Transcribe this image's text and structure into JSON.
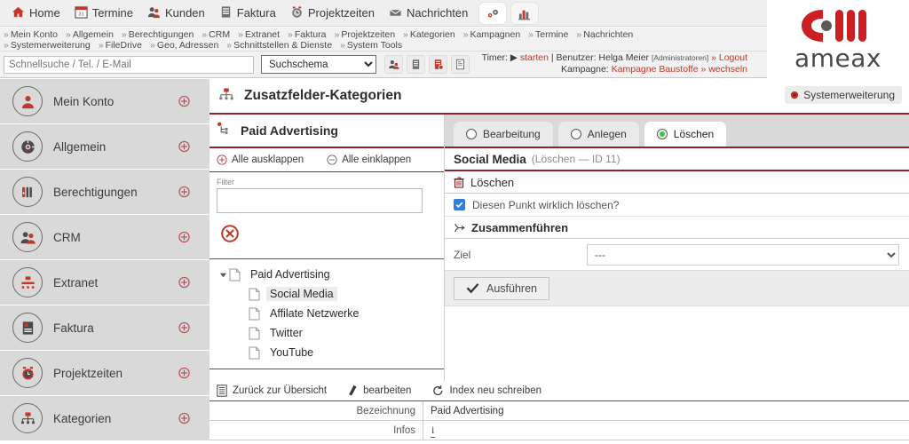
{
  "brand": {
    "accent": "#8d2230",
    "red": "#c0392b",
    "wordmark": "ameax"
  },
  "topnav": {
    "items": [
      {
        "label": "Home",
        "icon": "home-icon"
      },
      {
        "label": "Termine",
        "icon": "calendar-icon"
      },
      {
        "label": "Kunden",
        "icon": "customers-icon"
      },
      {
        "label": "Faktura",
        "icon": "invoice-icon"
      },
      {
        "label": "Projektzeiten",
        "icon": "clock-icon"
      },
      {
        "label": "Nachrichten",
        "icon": "mail-icon"
      }
    ],
    "buttons": [
      {
        "name": "settings-gear-icon"
      },
      {
        "name": "bar-chart-icon"
      }
    ]
  },
  "breadcrumbs": {
    "row1": [
      "Mein Konto",
      "Allgemein",
      "Berechtigungen",
      "CRM",
      "Extranet",
      "Faktura",
      "Projektzeiten",
      "Kategorien",
      "Kampagnen",
      "Termine",
      "Nachrichten"
    ],
    "row2": [
      "Systemerweiterung",
      "FileDrive",
      "Geo, Adressen",
      "Schnittstellen & Dienste",
      "System Tools"
    ]
  },
  "search": {
    "placeholder": "Schnellsuche / Tel. / E-Mail",
    "value": "",
    "schema_selected": "Suchschema",
    "schema_options": [
      "Suchschema"
    ],
    "icons": [
      "contacts-icon",
      "company-icon",
      "lead-icon",
      "document-icon"
    ]
  },
  "timer": {
    "label": "Timer:",
    "start": "starten",
    "separator": "|",
    "user_label": "Benutzer:",
    "user": "Helga Meier",
    "role": "[Administratoren]",
    "logout": "» Logout",
    "campaign_label": "Kampagne:",
    "campaign": "Kampagne Baustoffe",
    "switch": "» wechseln"
  },
  "sidebar": {
    "items": [
      {
        "label": "Mein Konto",
        "icon": "user-account-icon"
      },
      {
        "label": "Allgemein",
        "icon": "settings-disc-icon"
      },
      {
        "label": "Berechtigungen",
        "icon": "permissions-icon"
      },
      {
        "label": "CRM",
        "icon": "crm-people-icon"
      },
      {
        "label": "Extranet",
        "icon": "extranet-icon"
      },
      {
        "label": "Faktura",
        "icon": "invoice-doc-icon"
      },
      {
        "label": "Projektzeiten",
        "icon": "project-time-icon"
      },
      {
        "label": "Kategorien",
        "icon": "categories-icon"
      }
    ],
    "expand_icon": "plus-circle-icon"
  },
  "page": {
    "title": "Zusatzfelder-Kategorien",
    "title_icon": "sitemap-icon",
    "system_badge": "Systemerweiterung"
  },
  "tree_panel": {
    "title": "Paid Advertising",
    "title_icon": "tree-node-icon",
    "expand_all": "Alle ausklappen",
    "collapse_all": "Alle einklappen",
    "filter_label": "Filter",
    "filter_value": "",
    "filter_placeholder": "",
    "delete_icon": "delete-circle-icon",
    "nodes": [
      {
        "label": "Paid Advertising",
        "level": 0,
        "expanded": true,
        "selected": false
      },
      {
        "label": "Social Media",
        "level": 1,
        "expanded": false,
        "selected": true
      },
      {
        "label": "Affilate Netzwerke",
        "level": 1,
        "expanded": false,
        "selected": false
      },
      {
        "label": "Twitter",
        "level": 1,
        "expanded": false,
        "selected": false
      },
      {
        "label": "YouTube",
        "level": 1,
        "expanded": false,
        "selected": false
      }
    ]
  },
  "tabs": [
    {
      "label": "Bearbeitung",
      "active": false
    },
    {
      "label": "Anlegen",
      "active": false
    },
    {
      "label": "Löschen",
      "active": true
    }
  ],
  "detail": {
    "name": "Social Media",
    "meta": "(Löschen — ID 11)",
    "delete_section": {
      "title": "Löschen",
      "icon": "trash-icon"
    },
    "confirm_label": "Diesen Punkt wirklich löschen?",
    "confirm_checked": true,
    "merge_section": {
      "title": "Zusammenführen",
      "icon": "merge-icon"
    },
    "target_label": "Ziel",
    "target_value": "---",
    "target_options": [
      "---"
    ],
    "execute_label": "Ausführen",
    "execute_icon": "check-icon"
  },
  "bottom": {
    "tools": [
      {
        "label": "Zurück zur Übersicht",
        "icon": "list-icon"
      },
      {
        "label": "bearbeiten",
        "icon": "pencil-icon"
      },
      {
        "label": "Index neu schreiben",
        "icon": "refresh-icon"
      }
    ],
    "rows": [
      {
        "key": "Bezeichnung",
        "value": "Paid Advertising"
      },
      {
        "key": "Infos",
        "value": "i"
      }
    ]
  }
}
